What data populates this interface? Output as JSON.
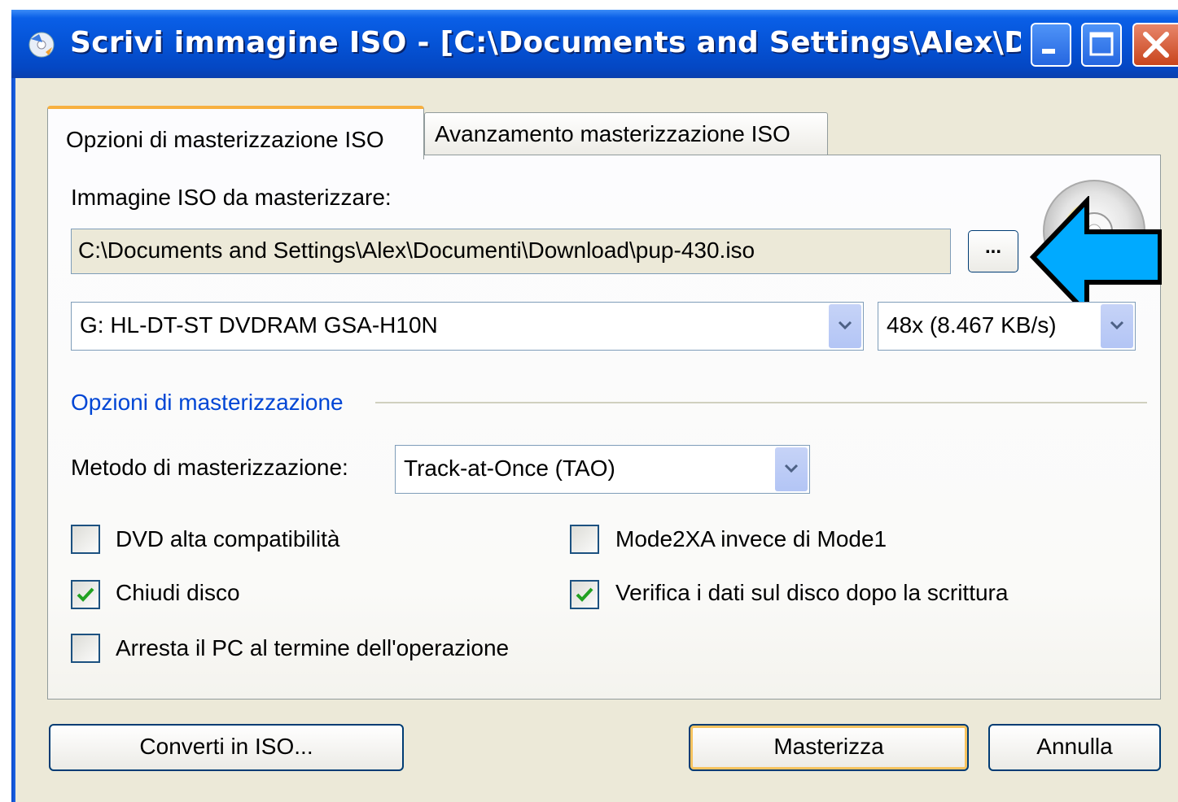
{
  "window": {
    "title": "Scrivi immagine ISO - [C:\\Documents and Settings\\Alex\\Docum...",
    "icons": [
      "app-disc-icon",
      "minimize-icon",
      "maximize-icon",
      "close-icon"
    ]
  },
  "tabs": [
    {
      "label": "Opzioni di masterizzazione ISO",
      "active": true
    },
    {
      "label": "Avanzamento masterizzazione ISO",
      "active": false
    }
  ],
  "image_section": {
    "label": "Immagine ISO da masterizzare:",
    "path_value": "C:\\Documents and Settings\\Alex\\Documenti\\Download\\pup-430.iso",
    "browse_label": "..."
  },
  "drive": {
    "selected": "G: HL-DT-ST DVDRAM GSA-H10N"
  },
  "speed": {
    "selected": "48x (8.467 KB/s)"
  },
  "options_group": {
    "title": "Opzioni di masterizzazione",
    "method_label": "Metodo di masterizzazione:",
    "method_selected": "Track-at-Once (TAO)",
    "checkboxes": [
      {
        "label": "DVD alta compatibilità",
        "checked": false
      },
      {
        "label": "Mode2XA invece di Mode1",
        "checked": false
      },
      {
        "label": "Chiudi disco",
        "checked": true
      },
      {
        "label": "Verifica i dati sul disco dopo la scrittura",
        "checked": true
      },
      {
        "label": "Arresta il PC al termine dell'operazione",
        "checked": false
      }
    ]
  },
  "buttons": {
    "convert": "Converti in ISO...",
    "burn": "Masterizza",
    "cancel": "Annulla"
  },
  "colors": {
    "titlebar": "#0553d6",
    "group_title": "#0046d5",
    "annotation_arrow": "#00aaff",
    "checkmark": "#21a121"
  }
}
